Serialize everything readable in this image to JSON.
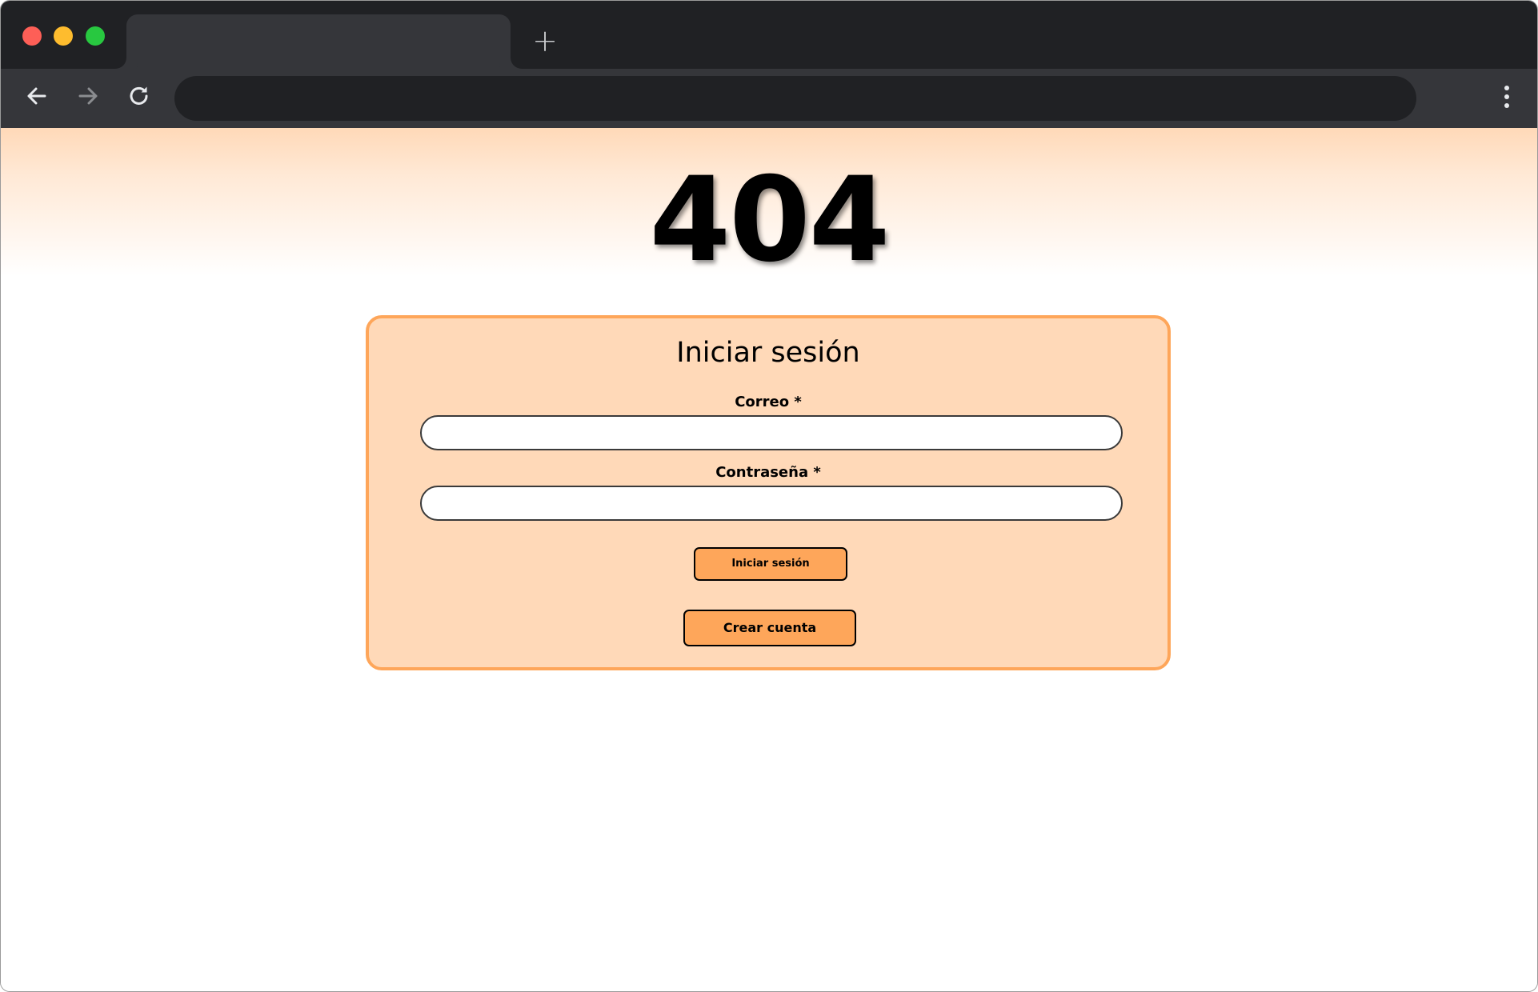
{
  "browser": {
    "tab_title": "",
    "new_tab_symbol": "+",
    "address": "",
    "icons": {
      "back": "arrow-left-icon",
      "forward": "arrow-right-icon",
      "reload": "reload-icon",
      "menu": "kebab-menu-icon"
    }
  },
  "page": {
    "error_code": "404"
  },
  "login": {
    "title": "Iniciar sesión",
    "email_label": "Correo *",
    "email_value": "",
    "password_label": "Contraseña *",
    "password_value": "",
    "submit_label": "Iniciar sesión",
    "register_label": "Crear cuenta"
  },
  "colors": {
    "accent_orange": "#fea65a",
    "card_background": "#ffd9b8",
    "chrome_dark": "#202124",
    "chrome_toolbar": "#35363a"
  }
}
